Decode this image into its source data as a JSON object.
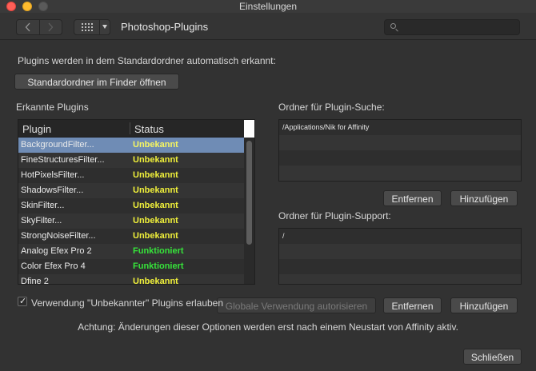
{
  "window": {
    "title": "Einstellungen"
  },
  "toolbar": {
    "back_icon": "chevron-left-icon",
    "forward_icon": "chevron-right-icon",
    "grid_icon": "grid-icon",
    "pane_title": "Photoshop-Plugins",
    "search": {
      "value": "",
      "placeholder": ""
    }
  },
  "main": {
    "intro_text": "Plugins werden in dem Standardordner automatisch erkannt:",
    "open_default_folder_label": "Standardordner im Finder öffnen",
    "detected_plugins_label": "Erkannte Plugins",
    "plugins_table": {
      "columns": [
        "Plugin",
        "Status"
      ],
      "rows": [
        {
          "name": "BackgroundFilter...",
          "status": "Unbekannt",
          "kind": "unknown",
          "selected": true
        },
        {
          "name": "FineStructuresFilter...",
          "status": "Unbekannt",
          "kind": "unknown"
        },
        {
          "name": "HotPixelsFilter...",
          "status": "Unbekannt",
          "kind": "unknown"
        },
        {
          "name": "ShadowsFilter...",
          "status": "Unbekannt",
          "kind": "unknown"
        },
        {
          "name": "SkinFilter...",
          "status": "Unbekannt",
          "kind": "unknown"
        },
        {
          "name": "SkyFilter...",
          "status": "Unbekannt",
          "kind": "unknown"
        },
        {
          "name": "StrongNoiseFilter...",
          "status": "Unbekannt",
          "kind": "unknown"
        },
        {
          "name": "Analog Efex Pro 2",
          "status": "Funktioniert",
          "kind": "ok"
        },
        {
          "name": "Color Efex Pro 4",
          "status": "Funktioniert",
          "kind": "ok"
        },
        {
          "name": "Dfine 2",
          "status": "Unbekannt",
          "kind": "unknown"
        }
      ]
    },
    "search_folders": {
      "label": "Ordner für Plugin-Suche:",
      "items": [
        "/Applications/Nik for Affinity",
        "",
        "",
        ""
      ],
      "remove_label": "Entfernen",
      "add_label": "Hinzufügen"
    },
    "support_folders": {
      "label": "Ordner für Plugin-Support:",
      "items": [
        "/",
        "",
        "",
        ""
      ],
      "authorize_label": "Globale Verwendung autorisieren",
      "remove_label": "Entfernen",
      "add_label": "Hinzufügen"
    },
    "allow_unknown": {
      "checked": true,
      "label": "Verwendung \"Unbekannter\" Plugins erlauben"
    },
    "note": "Achtung: Änderungen dieser Optionen werden erst nach einem Neustart von Affinity aktiv.",
    "close_label": "Schließen"
  },
  "colors": {
    "status_unknown": "#f0f03a",
    "status_ok": "#36e43a",
    "selection": "#6f8cb5"
  }
}
